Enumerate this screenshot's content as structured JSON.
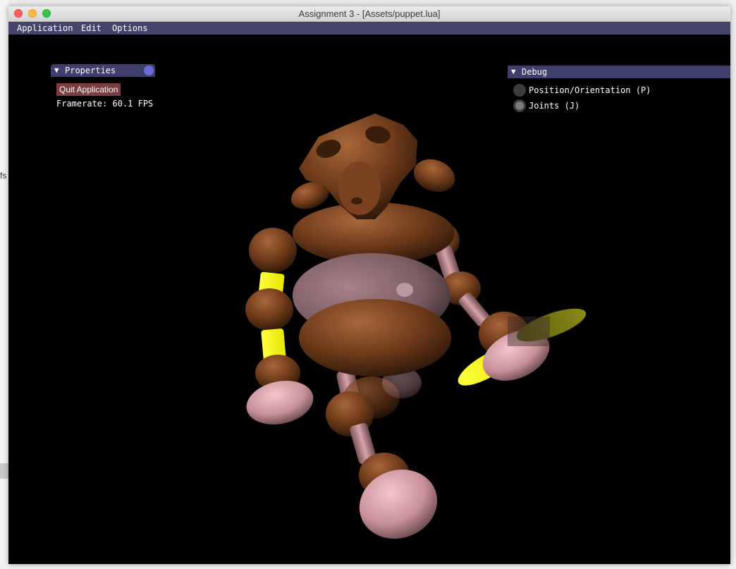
{
  "window": {
    "title": "Assignment 3 - [Assets/puppet.lua]"
  },
  "menubar": {
    "items": [
      "Application",
      "Edit",
      "Options"
    ]
  },
  "properties": {
    "title": "Properties",
    "arrow": "▼",
    "quit_label": "Quit Application",
    "framerate": "Framerate: 60.1 FPS"
  },
  "debug": {
    "title": "Debug",
    "arrow": "▼",
    "options": [
      {
        "label": "Position/Orientation (P)",
        "selected": false
      },
      {
        "label": "Joints (J)",
        "selected": true
      }
    ]
  },
  "desktop": {
    "left_fragment": "fs"
  },
  "colors": {
    "menubar_bg": "#45456c",
    "panel_header_bg": "#3f3f6e",
    "quit_button_bg": "#7a3e3e",
    "viewport_bg": "#000000",
    "puppet_brown": "#6e3a1a",
    "puppet_pink": "#d9a0a8",
    "joint_highlight_yellow": "#ffff00"
  },
  "icons": [
    "close-icon",
    "minimize-icon",
    "zoom-icon",
    "collapse-arrow-icon",
    "collapse-circle-icon",
    "radio-icon"
  ]
}
